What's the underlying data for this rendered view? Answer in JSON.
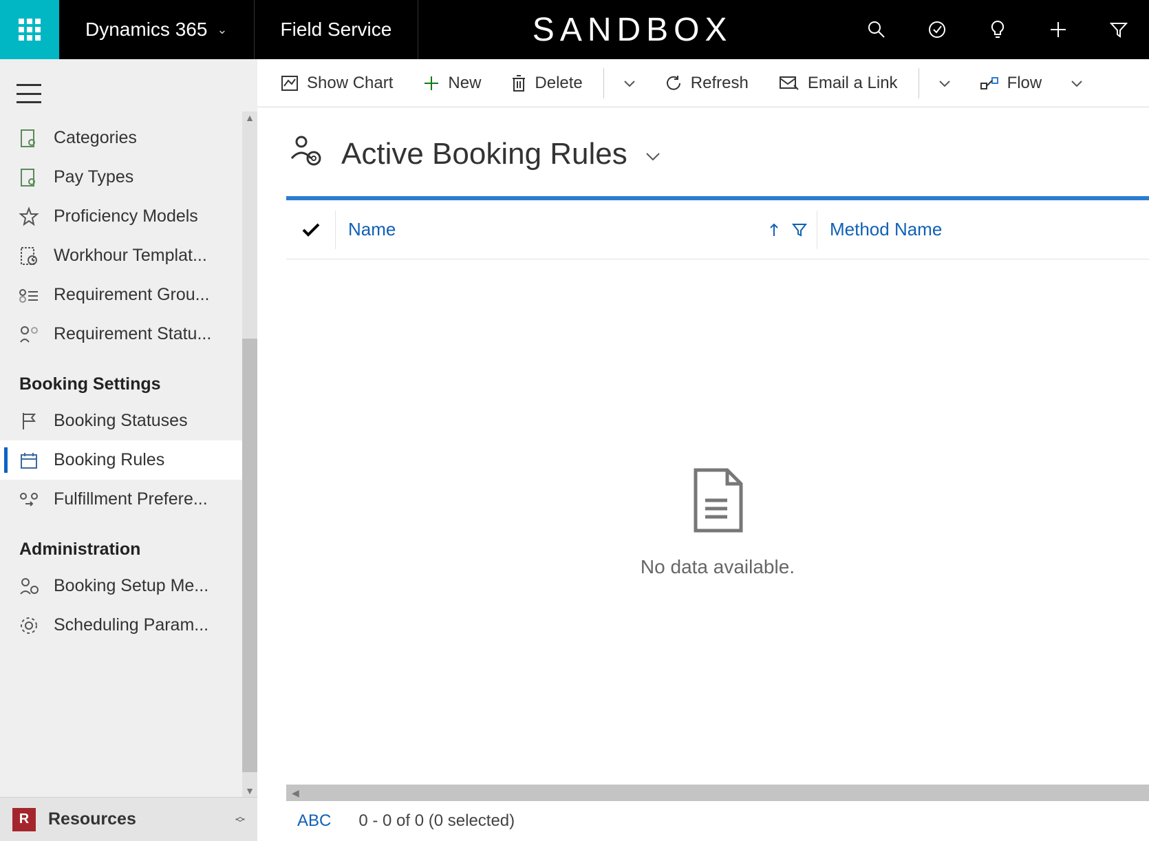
{
  "topbar": {
    "brand": "Dynamics 365",
    "module": "Field Service",
    "env": "SANDBOX"
  },
  "sidebar": {
    "items": [
      {
        "label": "Categories",
        "icon": "doc-person"
      },
      {
        "label": "Pay Types",
        "icon": "doc-person"
      },
      {
        "label": "Proficiency Models",
        "icon": "star"
      },
      {
        "label": "Workhour Templat...",
        "icon": "doc-clock"
      },
      {
        "label": "Requirement Grou...",
        "icon": "people-list"
      },
      {
        "label": "Requirement Statu...",
        "icon": "person-branch"
      }
    ],
    "groups": [
      {
        "title": "Booking Settings",
        "items": [
          {
            "label": "Booking Statuses",
            "icon": "flag"
          },
          {
            "label": "Booking Rules",
            "icon": "calendar",
            "active": true
          },
          {
            "label": "Fulfillment Prefere...",
            "icon": "people-swap"
          }
        ]
      },
      {
        "title": "Administration",
        "items": [
          {
            "label": "Booking Setup Me...",
            "icon": "person-gear"
          },
          {
            "label": "Scheduling Param...",
            "icon": "gear"
          }
        ]
      }
    ]
  },
  "area": {
    "badge": "R",
    "name": "Resources"
  },
  "commands": {
    "showChart": "Show Chart",
    "new": "New",
    "delete": "Delete",
    "refresh": "Refresh",
    "emailLink": "Email a Link",
    "flow": "Flow"
  },
  "view": {
    "title": "Active Booking Rules"
  },
  "grid": {
    "columns": {
      "name": "Name",
      "method": "Method Name"
    },
    "empty": "No data available.",
    "footer": {
      "abc": "ABC",
      "paging": "0 - 0 of 0 (0 selected)"
    }
  }
}
